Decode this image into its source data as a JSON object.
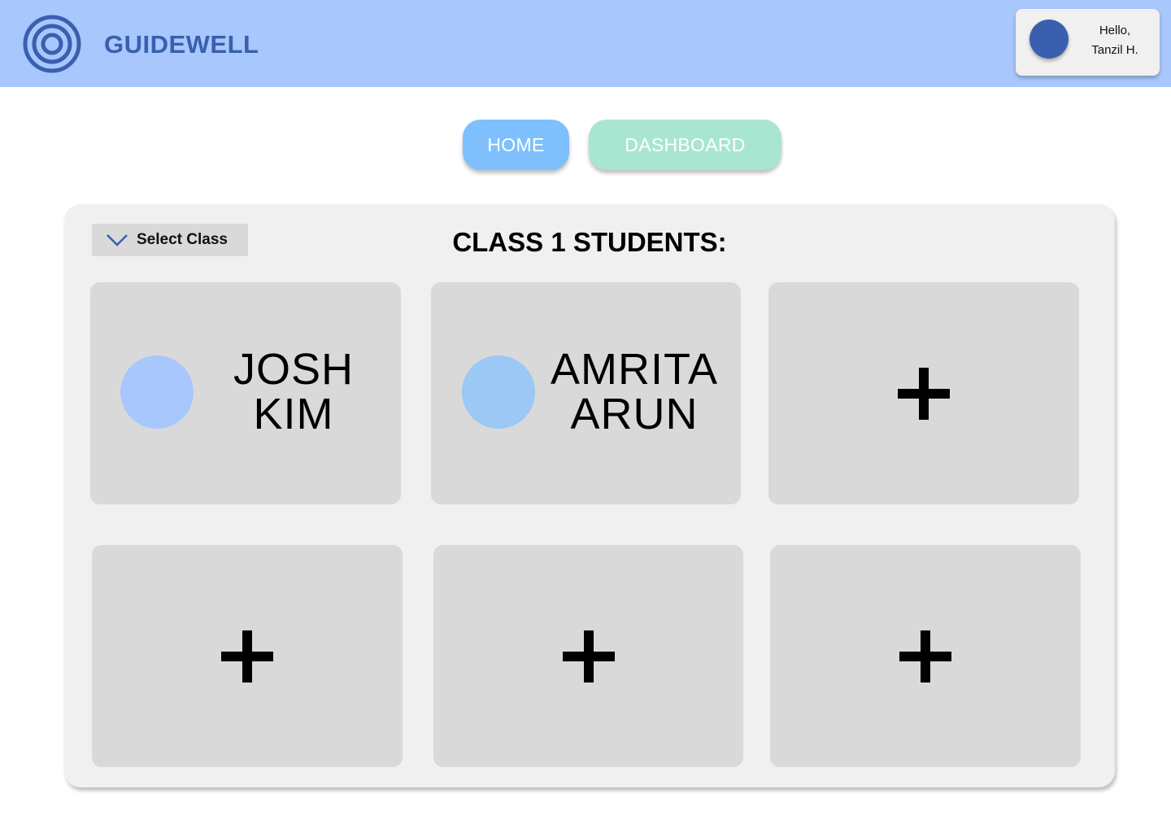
{
  "header": {
    "brand": "GUIDEWELL",
    "greeting_line1": "Hello,",
    "greeting_line2": "Tanzil H."
  },
  "nav": {
    "home_label": "HOME",
    "dashboard_label": "DASHBOARD"
  },
  "panel": {
    "select_label": "Select Class",
    "title": "CLASS 1 STUDENTS:",
    "students": [
      {
        "first": "JOSH",
        "last": "KIM"
      },
      {
        "first": "AMRITA",
        "last": "ARUN"
      }
    ]
  },
  "colors": {
    "header_bg": "#a7c7fd",
    "brand": "#3a5fae",
    "home_button": "#7ec0fd",
    "dashboard_button": "#a8e6d2",
    "card_bg": "#d9d9d9",
    "panel_bg": "#f0f0f0"
  },
  "icons": {
    "logo": "concentric-circles-icon",
    "select": "chevron-down-icon",
    "add": "plus-icon"
  }
}
